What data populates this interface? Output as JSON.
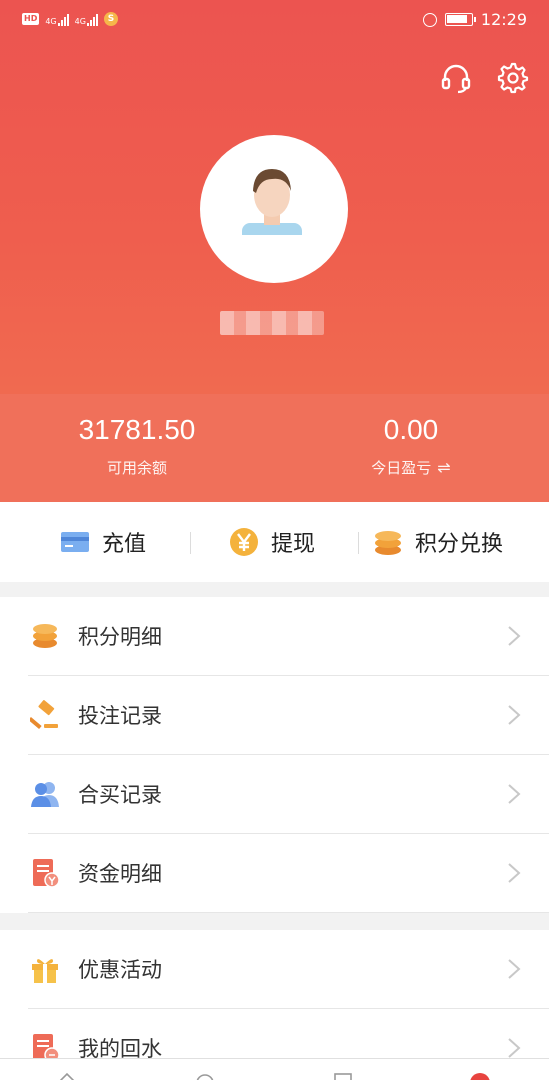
{
  "status_bar": {
    "hd": "HD",
    "net1": "4G",
    "net2": "4G",
    "coin": "S",
    "time": "12:29"
  },
  "header": {
    "icons": [
      "headset-icon",
      "gear-icon"
    ],
    "avatar": "avatar-image"
  },
  "balance": {
    "available_value": "31781.50",
    "available_label": "可用余额",
    "today_value": "0.00",
    "today_label": "今日盈亏",
    "swap_icon": "⇌"
  },
  "actions": {
    "recharge": "充值",
    "withdraw": "提现",
    "exchange": "积分兑换"
  },
  "menu": {
    "group1": [
      {
        "label": "积分明细",
        "icon": "coins-icon"
      },
      {
        "label": "投注记录",
        "icon": "gavel-icon"
      },
      {
        "label": "合买记录",
        "icon": "users-icon"
      },
      {
        "label": "资金明细",
        "icon": "bill-icon"
      }
    ],
    "group2": [
      {
        "label": "优惠活动",
        "icon": "gift-icon"
      },
      {
        "label": "我的回水",
        "icon": "receipt-icon"
      }
    ]
  },
  "colors": {
    "header": "#ec5450",
    "balance_bg": "#f0705a",
    "accent_orange": "#f2a23a",
    "accent_blue": "#5b8fe6"
  }
}
